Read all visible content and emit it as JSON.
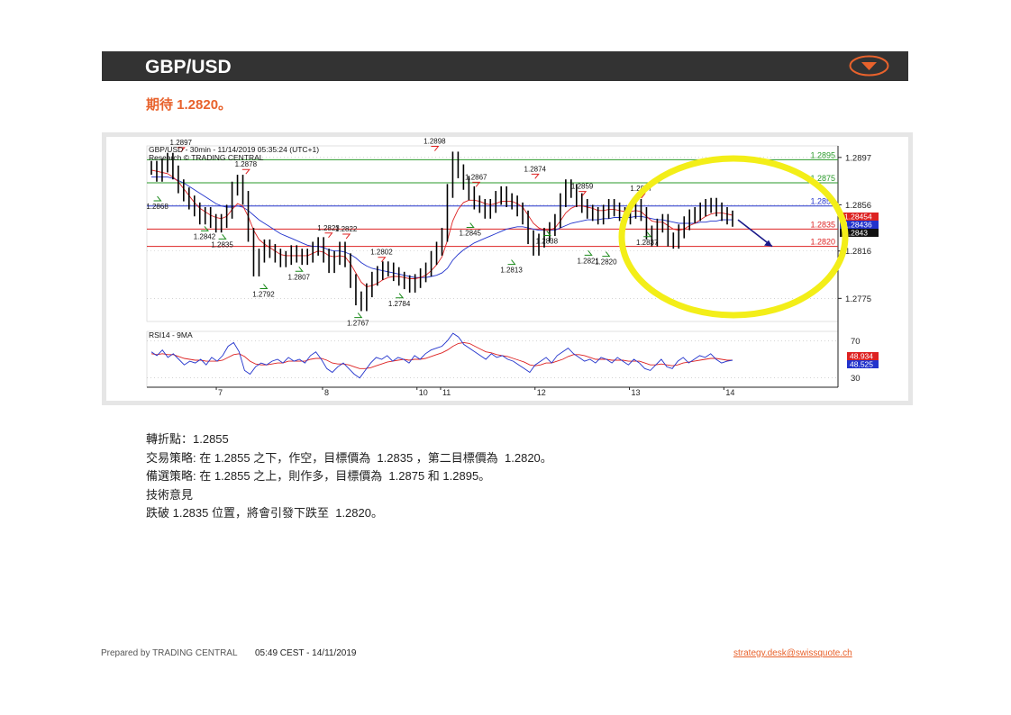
{
  "header": {
    "title": "GBP/USD",
    "menu_icon": "chevron-down-circle-icon",
    "menu_color": "#e8622c"
  },
  "subtitle": "期待 1.2820。",
  "chart_data": [
    {
      "type": "line",
      "title": "GBP/USD - 30min - 11/14/2019 05:35:24 (UTC+1)",
      "source_label": "Research © TRADING CENTRAL",
      "x_categories": [
        "7",
        "8",
        "10",
        "11",
        "12",
        "13",
        "14"
      ],
      "y_ticks": [
        1.2897,
        1.2856,
        1.2816,
        1.2775
      ],
      "ylim": [
        1.2755,
        1.2907
      ],
      "levels": [
        {
          "label": "1.2895",
          "value": 1.2895,
          "color": "#2a9a2a"
        },
        {
          "label": "1.2875",
          "value": 1.2875,
          "color": "#2a9a2a"
        },
        {
          "label": "1.2855",
          "value": 1.2855,
          "color": "#2233cc"
        },
        {
          "label": "1.2835",
          "value": 1.2835,
          "color": "#dd2222"
        },
        {
          "label": "1.2820",
          "value": 1.282,
          "color": "#dd2222"
        }
      ],
      "price_tags": [
        {
          "label": "1.28454",
          "value": 1.28454,
          "color": "#dd2222"
        },
        {
          "label": "1.28436",
          "value": 1.28436,
          "color": "#2233cc"
        },
        {
          "label": "1.2843",
          "value": 1.2843,
          "color": "#111111"
        }
      ],
      "pivot_highs": [
        {
          "label": "1.2897",
          "x": 0.05,
          "value": 1.2897
        },
        {
          "label": "1.2878",
          "x": 0.16,
          "value": 1.2878
        },
        {
          "label": "1.2823",
          "x": 0.3,
          "value": 1.2823
        },
        {
          "label": "1.2822",
          "x": 0.33,
          "value": 1.2822
        },
        {
          "label": "1.2802",
          "x": 0.39,
          "value": 1.2802
        },
        {
          "label": "1.2898",
          "x": 0.48,
          "value": 1.2898
        },
        {
          "label": "1.2867",
          "x": 0.55,
          "value": 1.2867
        },
        {
          "label": "1.2874",
          "x": 0.65,
          "value": 1.2874
        },
        {
          "label": "1.2859",
          "x": 0.73,
          "value": 1.2859
        },
        {
          "label": "1.2857",
          "x": 0.83,
          "value": 1.2857
        }
      ],
      "pivot_lows": [
        {
          "label": "1.2868",
          "x": 0.01,
          "value": 1.2868
        },
        {
          "label": "1.2842",
          "x": 0.09,
          "value": 1.2842
        },
        {
          "label": "1.2835",
          "x": 0.12,
          "value": 1.2835
        },
        {
          "label": "1.2792",
          "x": 0.19,
          "value": 1.2792
        },
        {
          "label": "1.2807",
          "x": 0.25,
          "value": 1.2807
        },
        {
          "label": "1.2767",
          "x": 0.35,
          "value": 1.2767
        },
        {
          "label": "1.2784",
          "x": 0.42,
          "value": 1.2784
        },
        {
          "label": "1.2845",
          "x": 0.54,
          "value": 1.2845
        },
        {
          "label": "1.2813",
          "x": 0.61,
          "value": 1.2813
        },
        {
          "label": "1.2838",
          "x": 0.67,
          "value": 1.2838
        },
        {
          "label": "1.2821",
          "x": 0.74,
          "value": 1.2821
        },
        {
          "label": "1.2820",
          "x": 0.77,
          "value": 1.282
        },
        {
          "label": "1.2837",
          "x": 0.84,
          "value": 1.2837
        }
      ],
      "price_series": [
        1.2888,
        1.2882,
        1.289,
        1.2895,
        1.2884,
        1.2872,
        1.2865,
        1.2858,
        1.2852,
        1.2845,
        1.2848,
        1.2842,
        1.2838,
        1.2842,
        1.285,
        1.287,
        1.2876,
        1.2862,
        1.283,
        1.28,
        1.2812,
        1.282,
        1.2816,
        1.2812,
        1.2808,
        1.281,
        1.2815,
        1.2812,
        1.281,
        1.2812,
        1.2818,
        1.2822,
        1.2812,
        1.2803,
        1.281,
        1.2818,
        1.2808,
        1.279,
        1.2775,
        1.277,
        1.2782,
        1.2792,
        1.2797,
        1.2801,
        1.28,
        1.2796,
        1.2792,
        1.2789,
        1.2786,
        1.279,
        1.2795,
        1.28,
        1.281,
        1.2818,
        1.283,
        1.2868,
        1.2896,
        1.2885,
        1.2875,
        1.2866,
        1.2858,
        1.2855,
        1.285,
        1.2855,
        1.2862,
        1.2866,
        1.286,
        1.2858,
        1.2852,
        1.2845,
        1.2828,
        1.2818,
        1.2825,
        1.283,
        1.2835,
        1.2842,
        1.286,
        1.2872,
        1.2868,
        1.286,
        1.2855,
        1.285,
        1.2848,
        1.2845,
        1.285,
        1.2855,
        1.2852,
        1.2848,
        1.2845,
        1.285,
        1.2855,
        1.2848,
        1.2832,
        1.2826,
        1.2838,
        1.2842,
        1.2826,
        1.2824,
        1.2833,
        1.284,
        1.2846,
        1.2848,
        1.2852,
        1.2855,
        1.2856,
        1.2852,
        1.2848,
        1.2845,
        1.2843
      ],
      "ma_fast": [
        1.2886,
        1.2885,
        1.2884,
        1.2883,
        1.288,
        1.2876,
        1.287,
        1.2864,
        1.2858,
        1.2853,
        1.285,
        1.2847,
        1.2845,
        1.2844,
        1.2846,
        1.2852,
        1.2857,
        1.2855,
        1.2846,
        1.2834,
        1.2826,
        1.2822,
        1.2819,
        1.2816,
        1.2813,
        1.2812,
        1.2812,
        1.2812,
        1.2812,
        1.2812,
        1.2814,
        1.2816,
        1.2815,
        1.2812,
        1.2811,
        1.2812,
        1.2811,
        1.2805,
        1.2797,
        1.2789,
        1.2785,
        1.2786,
        1.2788,
        1.2791,
        1.2793,
        1.2794,
        1.2794,
        1.2793,
        1.2792,
        1.2792,
        1.2793,
        1.2795,
        1.2799,
        1.2804,
        1.2811,
        1.2825,
        1.2842,
        1.2852,
        1.2858,
        1.286,
        1.286,
        1.2859,
        1.2857,
        1.2856,
        1.2857,
        1.2859,
        1.2859,
        1.2859,
        1.2857,
        1.2854,
        1.2847,
        1.284,
        1.2836,
        1.2834,
        1.2834,
        1.2836,
        1.2842,
        1.2849,
        1.2853,
        1.2855,
        1.2855,
        1.2854,
        1.2853,
        1.2851,
        1.2851,
        1.2852,
        1.2852,
        1.2851,
        1.285,
        1.285,
        1.2851,
        1.285,
        1.2846,
        1.2842,
        1.2841,
        1.2841,
        1.2838,
        1.2835,
        1.2834,
        1.2835,
        1.2838,
        1.284,
        1.2843,
        1.2846,
        1.2848,
        1.2849,
        1.2849,
        1.2848,
        1.2847
      ],
      "ma_slow": [
        1.288,
        1.288,
        1.288,
        1.288,
        1.2879,
        1.2877,
        1.2875,
        1.2872,
        1.2869,
        1.2866,
        1.2863,
        1.286,
        1.2857,
        1.2855,
        1.2854,
        1.2854,
        1.2855,
        1.2854,
        1.2851,
        1.2847,
        1.2843,
        1.284,
        1.2837,
        1.2834,
        1.2831,
        1.2829,
        1.2827,
        1.2825,
        1.2823,
        1.2821,
        1.282,
        1.282,
        1.2819,
        1.2817,
        1.2816,
        1.2816,
        1.2815,
        1.2813,
        1.281,
        1.2806,
        1.2803,
        1.2801,
        1.28,
        1.2799,
        1.2798,
        1.2797,
        1.2796,
        1.2795,
        1.2794,
        1.2793,
        1.2793,
        1.2793,
        1.2794,
        1.2795,
        1.2797,
        1.2801,
        1.2808,
        1.2813,
        1.2817,
        1.282,
        1.2823,
        1.2825,
        1.2827,
        1.2829,
        1.2831,
        1.2833,
        1.2835,
        1.2836,
        1.2837,
        1.2837,
        1.2836,
        1.2835,
        1.2834,
        1.2834,
        1.2834,
        1.2834,
        1.2836,
        1.2838,
        1.284,
        1.2841,
        1.2842,
        1.2843,
        1.2843,
        1.2843,
        1.2844,
        1.2844,
        1.2845,
        1.2845,
        1.2845,
        1.2845,
        1.2846,
        1.2846,
        1.2845,
        1.2844,
        1.2843,
        1.2843,
        1.2842,
        1.2841,
        1.284,
        1.284,
        1.284,
        1.284,
        1.2841,
        1.2841,
        1.2842,
        1.2842,
        1.2843,
        1.2843,
        1.2843
      ],
      "forecast": {
        "from": 1.2843,
        "to": 1.282
      },
      "highlight": "target zone circled in yellow"
    },
    {
      "type": "line",
      "title": "RSI14 - 9MA",
      "y_ticks": [
        70,
        30
      ],
      "ylim": [
        20,
        80
      ],
      "value_tags": [
        {
          "label": "48.934",
          "value": 48.934,
          "color": "#dd2222"
        },
        {
          "label": "48.525",
          "value": 48.525,
          "color": "#2233cc"
        }
      ],
      "rsi": [
        58,
        54,
        60,
        52,
        56,
        50,
        44,
        48,
        46,
        50,
        44,
        52,
        48,
        54,
        64,
        68,
        58,
        38,
        34,
        42,
        46,
        44,
        48,
        50,
        46,
        52,
        48,
        50,
        46,
        54,
        58,
        50,
        40,
        36,
        42,
        46,
        40,
        34,
        30,
        38,
        46,
        52,
        50,
        54,
        48,
        52,
        50,
        46,
        54,
        50,
        56,
        60,
        62,
        64,
        70,
        78,
        74,
        66,
        62,
        58,
        54,
        50,
        56,
        52,
        54,
        50,
        48,
        44,
        40,
        36,
        44,
        48,
        52,
        46,
        54,
        58,
        62,
        56,
        52,
        48,
        50,
        46,
        52,
        50,
        46,
        52,
        48,
        44,
        50,
        46,
        40,
        38,
        44,
        50,
        42,
        40,
        48,
        52,
        46,
        50,
        54,
        52,
        56,
        50,
        46,
        48,
        49
      ],
      "rsi_ma": [
        56,
        55,
        56,
        55,
        55,
        53,
        51,
        50,
        49,
        49,
        48,
        48,
        48,
        49,
        52,
        55,
        56,
        53,
        48,
        45,
        44,
        44,
        45,
        46,
        46,
        48,
        48,
        48,
        48,
        50,
        51,
        51,
        49,
        46,
        45,
        45,
        44,
        42,
        40,
        40,
        41,
        43,
        45,
        47,
        48,
        49,
        50,
        49,
        50,
        50,
        51,
        53,
        55,
        57,
        60,
        64,
        67,
        68,
        67,
        64,
        61,
        58,
        57,
        55,
        54,
        53,
        51,
        49,
        47,
        44,
        43,
        44,
        46,
        46,
        48,
        50,
        53,
        55,
        55,
        54,
        52,
        50,
        50,
        50,
        49,
        49,
        49,
        48,
        48,
        48,
        46,
        44,
        44,
        45,
        44,
        43,
        44,
        46,
        47,
        48,
        49,
        50,
        51,
        51,
        50,
        49,
        49
      ]
    }
  ],
  "content": {
    "pivot_line": "轉折點：1.2855",
    "strategy_line": "交易策略: 在 1.2855 之下，作空，目標價為  1.2835 ，第二目標價為  1.2820。",
    "alt_line": "備選策略: 在 1.2855 之上，則作多，目標價為  1.2875 和 1.2895。",
    "tech_title": "技術意見",
    "tech_line": "跌破 1.2835 位置，將會引發下跌至  1.2820。"
  },
  "footer": {
    "prepared": "Prepared by TRADING CENTRAL",
    "time": "05:49 CEST  - 14/11/2019",
    "email": "strategy.desk@swissquote.ch"
  }
}
